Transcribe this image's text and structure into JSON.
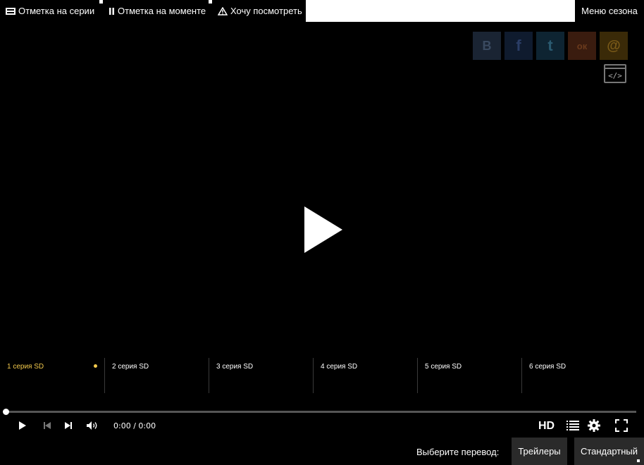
{
  "tabs": {
    "mark_series": "Отметка на серии",
    "mark_moment": "Отметка на моменте",
    "want_watch": "Хочу посмотреть",
    "season_menu": "Меню сезона"
  },
  "share": {
    "icons": [
      "vk-icon",
      "facebook-icon",
      "twitter-icon",
      "odnoklassniki-icon",
      "mailru-icon"
    ],
    "glyphs": [
      "B",
      "f",
      "t",
      "ок",
      "@"
    ],
    "colors": [
      "#1a2433",
      "#0f1b2e",
      "#0e2432",
      "#3a1c0f",
      "#3a2a08"
    ],
    "embed_label": "</>"
  },
  "episodes": [
    {
      "label": "1 серия SD",
      "active": true
    },
    {
      "label": "2 серия SD",
      "active": false
    },
    {
      "label": "3 серия SD",
      "active": false
    },
    {
      "label": "4 серия SD",
      "active": false
    },
    {
      "label": "5 серия SD",
      "active": false
    },
    {
      "label": "6 серия SD",
      "active": false
    }
  ],
  "controls": {
    "time": "0:00 / 0:00",
    "quality": "HD",
    "progress": 0
  },
  "translation": {
    "label": "Выберите перевод:",
    "options": [
      "Трейлеры",
      "Стандартный"
    ]
  },
  "colors": {
    "accent": "#f2c94c",
    "background": "#000000"
  }
}
